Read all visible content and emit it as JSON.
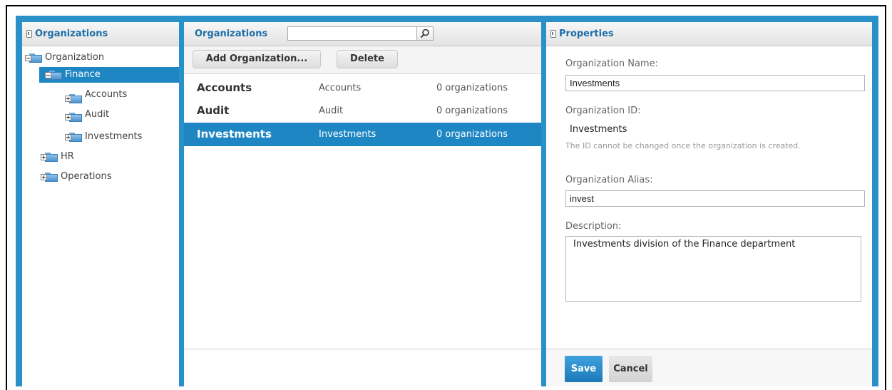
{
  "left_panel": {
    "title": "Organizations",
    "tree": [
      {
        "label": "Organization",
        "expanded": true
      },
      {
        "label": "Finance",
        "expanded": true,
        "selected": true
      },
      {
        "label": "Accounts"
      },
      {
        "label": "Audit"
      },
      {
        "label": "Investments"
      },
      {
        "label": "HR"
      },
      {
        "label": "Operations"
      }
    ]
  },
  "middle_panel": {
    "title": "Organizations",
    "search": {
      "value": "",
      "placeholder": ""
    },
    "add_button": "Add Organization...",
    "delete_button": "Delete",
    "rows": [
      {
        "name": "Accounts",
        "alias": "Accounts",
        "count": "0 organizations"
      },
      {
        "name": "Audit",
        "alias": "Audit",
        "count": "0 organizations"
      },
      {
        "name": "Investments",
        "alias": "Investments",
        "count": "0 organizations",
        "selected": true
      }
    ]
  },
  "right_panel": {
    "title": "Properties",
    "name_label": "Organization Name:",
    "name_value": "Investments",
    "id_label": "Organization ID:",
    "id_value": "Investments",
    "id_hint": "The ID cannot be changed once the organization is created.",
    "alias_label": "Organization Alias:",
    "alias_value": "invest",
    "description_label": "Description:",
    "description_value": "Investments division of the Finance department",
    "save_button": "Save",
    "cancel_button": "Cancel"
  },
  "colors": {
    "accent": "#2a90c8",
    "selection": "#1f86c4",
    "header_text": "#1d6fa8"
  },
  "icons": [
    "panel-toggle-icon",
    "folder-icon",
    "expand-icon",
    "collapse-icon",
    "search-icon"
  ]
}
